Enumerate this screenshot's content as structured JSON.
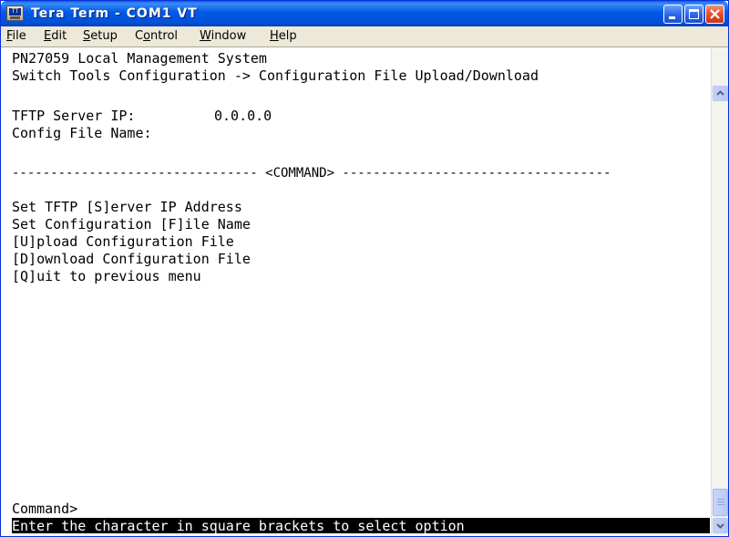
{
  "window": {
    "title": "Tera Term - COM1 VT",
    "icon_name": "tera-term-icon"
  },
  "menubar": {
    "items": [
      {
        "accel": "F",
        "rest": "ile"
      },
      {
        "accel": "E",
        "rest": "dit"
      },
      {
        "accel": "S",
        "rest": "etup"
      },
      {
        "pre": "C",
        "accel": "o",
        "rest": "ntrol"
      },
      {
        "accel": "W",
        "rest": "indow"
      },
      {
        "accel": "H",
        "rest": "elp"
      }
    ]
  },
  "terminal": {
    "header_line1": "PN27059 Local Management System",
    "header_line2": "Switch Tools Configuration -> Configuration File Upload/Download",
    "tftp_label": "TFTP Server IP:",
    "tftp_value": "0.0.0.0",
    "config_label": "Config File Name:",
    "config_value": "",
    "separator": "-------------------------------- <COMMAND> -----------------------------------",
    "commands": [
      "Set TFTP [S]erver IP Address",
      "Set Configuration [F]ile Name",
      "[U]pload Configuration File",
      "[D]ownload Configuration File",
      "[Q]uit to previous menu"
    ],
    "prompt": "Command>",
    "status": "Enter the character in square brackets to select option"
  },
  "colors": {
    "titlebar": "#0058e6",
    "close_button": "#e14b23",
    "menubar_bg": "#ece9d8",
    "terminal_bg": "#ffffff",
    "terminal_fg": "#000000",
    "status_bg": "#000000",
    "status_fg": "#ffffff"
  }
}
